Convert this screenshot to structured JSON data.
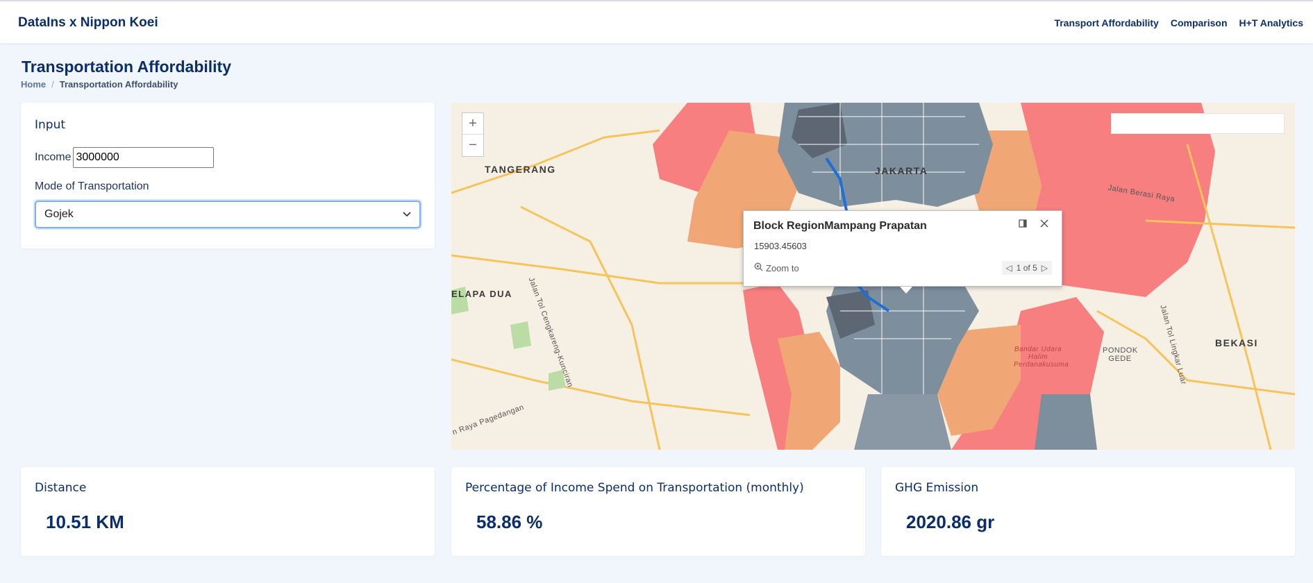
{
  "header": {
    "brand": "DataIns x Nippon Koei",
    "nav": [
      "Transport Affordability",
      "Comparison",
      "H+T Analytics"
    ]
  },
  "page": {
    "title": "Transportation Affordability",
    "breadcrumb": {
      "home": "Home",
      "separator": "/",
      "current": "Transportation Affordability"
    }
  },
  "input": {
    "title": "Input",
    "income_label": "Income",
    "income_value": "3000000",
    "mode_label": "Mode of Transportation",
    "mode_selected": "Gojek"
  },
  "map": {
    "zoom_in": "+",
    "zoom_out": "−",
    "labels": {
      "tangerang": "TANGERANG",
      "jakarta": "JAKARTA",
      "bekasi": "BEKASI",
      "kelapa_dua": "ELAPA DUA",
      "pondok_gede": "PONDOK GEDE",
      "bandara": "Bandar Udara Halim Perdanakusuma",
      "jalan_cengkareng": "Jalan Tol Cengkareng-Kunciran",
      "jalan_pagedangan": "n Raya Pagedangan",
      "jalan_lingkar_luar": "Jalan Tol Lingkar Luar",
      "jalan_berasi": "Jalan Berasi Raya"
    },
    "popup": {
      "title": "Block RegionMampang Prapatan",
      "value": "15903.45603",
      "zoom_to": "Zoom to",
      "pager": "1 of 5"
    },
    "colors": {
      "red": "#f77f7f",
      "orange": "#f0a775",
      "slate": "#7d8e9d",
      "dark": "#5d6773",
      "route": "#1f6fd6"
    },
    "icons": {
      "zoom": "zoom-in-icon",
      "dock": "dock-icon",
      "close": "close-icon"
    }
  },
  "stats": {
    "distance": {
      "title": "Distance",
      "value": "10.51 KM"
    },
    "percentage": {
      "title": "Percentage of Income Spend on Transportation (monthly)",
      "value": "58.86 %"
    },
    "ghg": {
      "title": "GHG Emission",
      "value": "2020.86 gr"
    }
  }
}
